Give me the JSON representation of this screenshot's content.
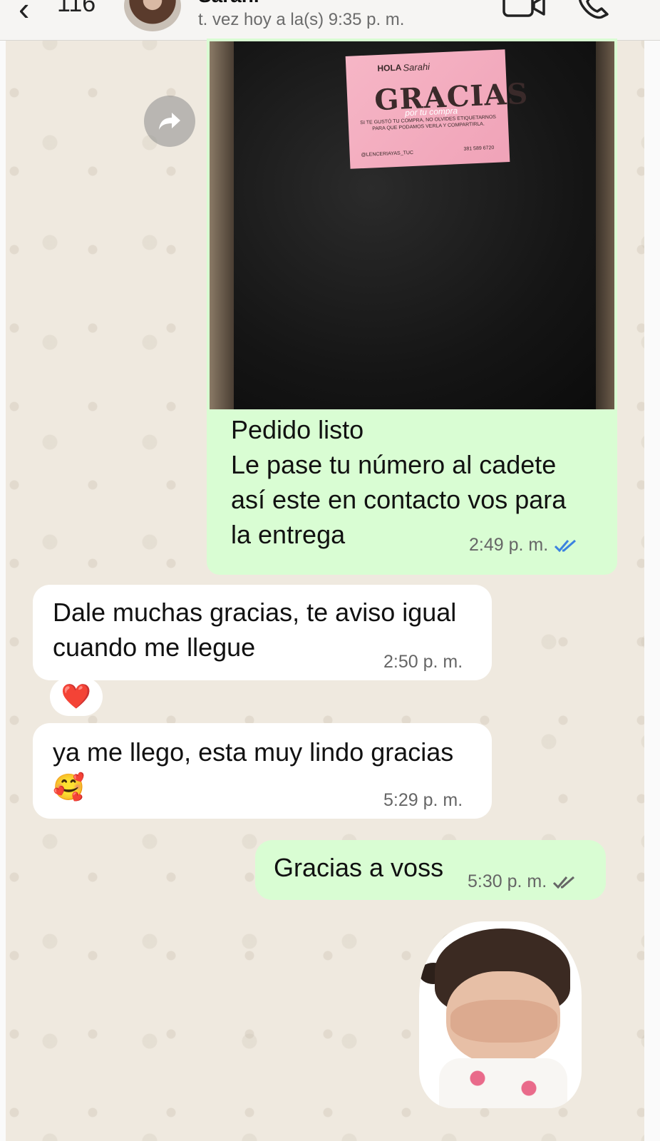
{
  "header": {
    "back_count": "116",
    "contact_name": "Sarahi",
    "status": "t. vez hoy a la(s) 9:35 p. m."
  },
  "photo_card": {
    "hola": "HOLA",
    "name": "Sarahi",
    "title": "GRACIAS",
    "subtitle": "por tu compra",
    "message": "SI TE GUSTÓ TU COMPRA, NO OLVIDES ETIQUETARNOS PARA QUE PODAMOS VERLA Y COMPARTIRLA.",
    "instagram": "@LENCERIAYAS_TUC",
    "phone": "381 589 6720"
  },
  "messages": [
    {
      "direction": "out",
      "lines": [
        "Pedido listo",
        "Le pase tu número al cadete",
        "así este en contacto vos para",
        "la entrega"
      ],
      "time": "2:49 p. m.",
      "status": "read"
    },
    {
      "direction": "in",
      "lines": [
        "Dale muchas gracias, te aviso igual",
        "cuando me llegue"
      ],
      "time": "2:50 p. m.",
      "reaction": "❤️"
    },
    {
      "direction": "in",
      "lines": [
        "ya me llego, esta muy lindo gracias",
        "🥰"
      ],
      "time": "5:29 p. m."
    },
    {
      "direction": "out",
      "lines": [
        "Gracias a voss"
      ],
      "time": "5:30 p. m.",
      "status": "delivered"
    }
  ],
  "colors": {
    "outgoing_bubble": "#d9fdd3",
    "incoming_bubble": "#ffffff",
    "read_ticks": "#3b82e0",
    "delivered_ticks": "#666666"
  },
  "icons": [
    "chevron-left-icon",
    "video-call-icon",
    "phone-icon",
    "forward-icon",
    "double-check-icon"
  ]
}
